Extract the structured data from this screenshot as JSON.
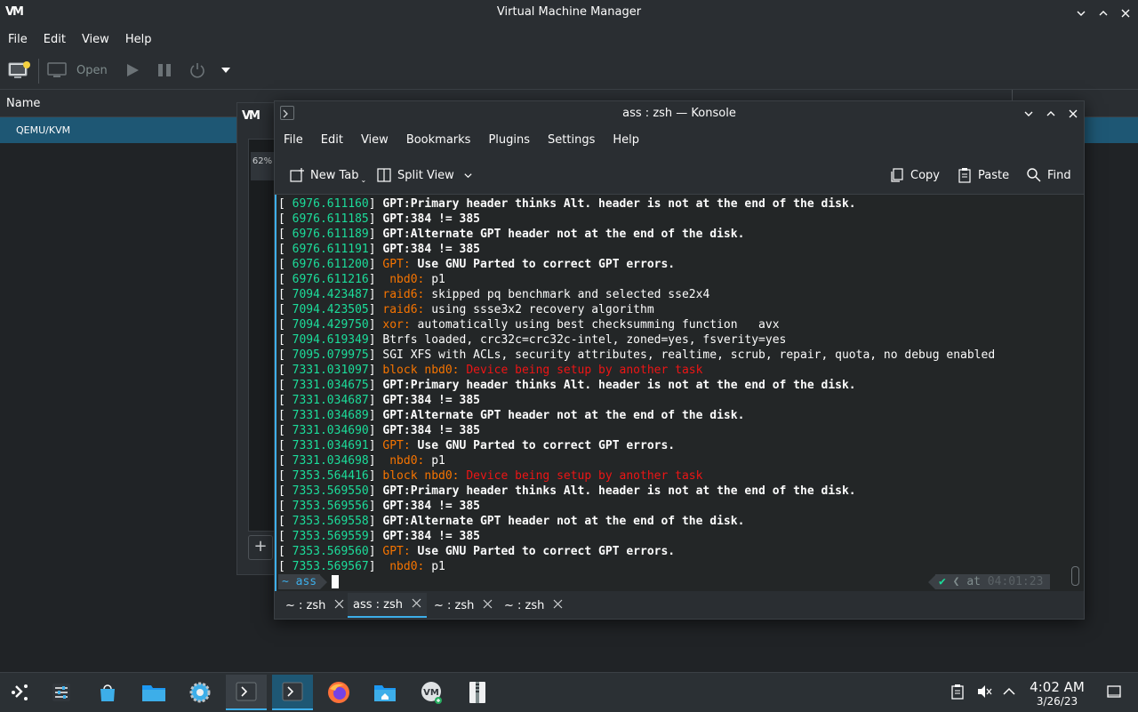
{
  "vmm": {
    "title": "Virtual Machine Manager",
    "logo": "VM",
    "menu": [
      "File",
      "Edit",
      "View",
      "Help"
    ],
    "toolbar": {
      "open_label": "Open"
    },
    "column_header": "Name",
    "connection_row": "QEMU/KVM"
  },
  "mid_dialog": {
    "logo": "VM",
    "percent": "62%",
    "add_label": "+"
  },
  "konsole": {
    "title": "ass : zsh — Konsole",
    "menu": [
      "File",
      "Edit",
      "View",
      "Bookmarks",
      "Plugins",
      "Settings",
      "Help"
    ],
    "toolbar": {
      "new_tab": "New Tab",
      "split_view": "Split View",
      "copy": "Copy",
      "paste": "Paste",
      "find": "Find"
    },
    "lines": [
      {
        "ts": "[ 6976.611160] ",
        "parts": [
          {
            "t": "GPT:Primary header thinks Alt. header is not at the end of the disk.",
            "c": "b"
          }
        ]
      },
      {
        "ts": "[ 6976.611185] ",
        "parts": [
          {
            "t": "GPT:384 != 385",
            "c": "b"
          }
        ]
      },
      {
        "ts": "[ 6976.611189] ",
        "parts": [
          {
            "t": "GPT:Alternate GPT header not at the end of the disk.",
            "c": "b"
          }
        ]
      },
      {
        "ts": "[ 6976.611191] ",
        "parts": [
          {
            "t": "GPT:384 != 385",
            "c": "b"
          }
        ]
      },
      {
        "ts": "[ 6976.611200] ",
        "parts": [
          {
            "t": "GPT: ",
            "c": "org"
          },
          {
            "t": "Use GNU Parted to correct GPT errors.",
            "c": "b"
          }
        ]
      },
      {
        "ts": "[ 6976.611216] ",
        "parts": [
          {
            "t": " nbd0: ",
            "c": "org"
          },
          {
            "t": "p1",
            "c": ""
          }
        ]
      },
      {
        "ts": "[ 7094.423487] ",
        "parts": [
          {
            "t": "raid6: ",
            "c": "org"
          },
          {
            "t": "skipped pq benchmark and selected sse2x4",
            "c": ""
          }
        ]
      },
      {
        "ts": "[ 7094.423505] ",
        "parts": [
          {
            "t": "raid6: ",
            "c": "org"
          },
          {
            "t": "using ssse3x2 recovery algorithm",
            "c": ""
          }
        ]
      },
      {
        "ts": "[ 7094.429750] ",
        "parts": [
          {
            "t": "xor: ",
            "c": "org"
          },
          {
            "t": "automatically using best checksumming function   avx",
            "c": ""
          }
        ]
      },
      {
        "ts": "[ 7094.619349] ",
        "parts": [
          {
            "t": "Btrfs loaded, crc32c=crc32c-intel, zoned=yes, fsverity=yes",
            "c": ""
          }
        ]
      },
      {
        "ts": "[ 7095.079975] ",
        "parts": [
          {
            "t": "SGI XFS with ACLs, security attributes, realtime, scrub, repair, quota, no debug enabled",
            "c": ""
          }
        ]
      },
      {
        "ts": "[ 7331.031097] ",
        "parts": [
          {
            "t": "block nbd0: ",
            "c": "org"
          },
          {
            "t": "Device being setup by another task",
            "c": "red"
          }
        ]
      },
      {
        "ts": "[ 7331.034675] ",
        "parts": [
          {
            "t": "GPT:Primary header thinks Alt. header is not at the end of the disk.",
            "c": "b"
          }
        ]
      },
      {
        "ts": "[ 7331.034687] ",
        "parts": [
          {
            "t": "GPT:384 != 385",
            "c": "b"
          }
        ]
      },
      {
        "ts": "[ 7331.034689] ",
        "parts": [
          {
            "t": "GPT:Alternate GPT header not at the end of the disk.",
            "c": "b"
          }
        ]
      },
      {
        "ts": "[ 7331.034690] ",
        "parts": [
          {
            "t": "GPT:384 != 385",
            "c": "b"
          }
        ]
      },
      {
        "ts": "[ 7331.034691] ",
        "parts": [
          {
            "t": "GPT: ",
            "c": "org"
          },
          {
            "t": "Use GNU Parted to correct GPT errors.",
            "c": "b"
          }
        ]
      },
      {
        "ts": "[ 7331.034698] ",
        "parts": [
          {
            "t": " nbd0: ",
            "c": "org"
          },
          {
            "t": "p1",
            "c": ""
          }
        ]
      },
      {
        "ts": "[ 7353.564416] ",
        "parts": [
          {
            "t": "block nbd0: ",
            "c": "org"
          },
          {
            "t": "Device being setup by another task",
            "c": "red"
          }
        ]
      },
      {
        "ts": "[ 7353.569550] ",
        "parts": [
          {
            "t": "GPT:Primary header thinks Alt. header is not at the end of the disk.",
            "c": "b"
          }
        ]
      },
      {
        "ts": "[ 7353.569556] ",
        "parts": [
          {
            "t": "GPT:384 != 385",
            "c": "b"
          }
        ]
      },
      {
        "ts": "[ 7353.569558] ",
        "parts": [
          {
            "t": "GPT:Alternate GPT header not at the end of the disk.",
            "c": "b"
          }
        ]
      },
      {
        "ts": "[ 7353.569559] ",
        "parts": [
          {
            "t": "GPT:384 != 385",
            "c": "b"
          }
        ]
      },
      {
        "ts": "[ 7353.569560] ",
        "parts": [
          {
            "t": "GPT: ",
            "c": "org"
          },
          {
            "t": "Use GNU Parted to correct GPT errors.",
            "c": "b"
          }
        ]
      },
      {
        "ts": "[ 7353.569567] ",
        "parts": [
          {
            "t": " nbd0: ",
            "c": "org"
          },
          {
            "t": "p1",
            "c": ""
          }
        ]
      }
    ],
    "prompt": {
      "dir": "~ ass",
      "right_at": "at",
      "right_time": "04:01:23"
    },
    "tabs": [
      {
        "label": "~ : zsh",
        "active": false
      },
      {
        "label": "ass : zsh",
        "active": true
      },
      {
        "label": "~ : zsh",
        "active": false
      },
      {
        "label": "~ : zsh",
        "active": false
      }
    ]
  },
  "taskbar": {
    "clock_time": "4:02 AM",
    "clock_date": "3/26/23",
    "items": [
      "app-launcher-icon",
      "system-settings-sliders-icon",
      "discover-store-icon",
      "dolphin-files-icon",
      "system-settings-icon",
      "konsole-icon",
      "konsole-icon",
      "firefox-icon",
      "home-folder-icon",
      "virt-manager-icon",
      "archive-manager-icon"
    ]
  },
  "colors": {
    "accent": "#3daee9",
    "timestamp": "#1cdc9a",
    "warning": "#f67400",
    "error": "#ed1515",
    "selection": "#1e5774"
  }
}
